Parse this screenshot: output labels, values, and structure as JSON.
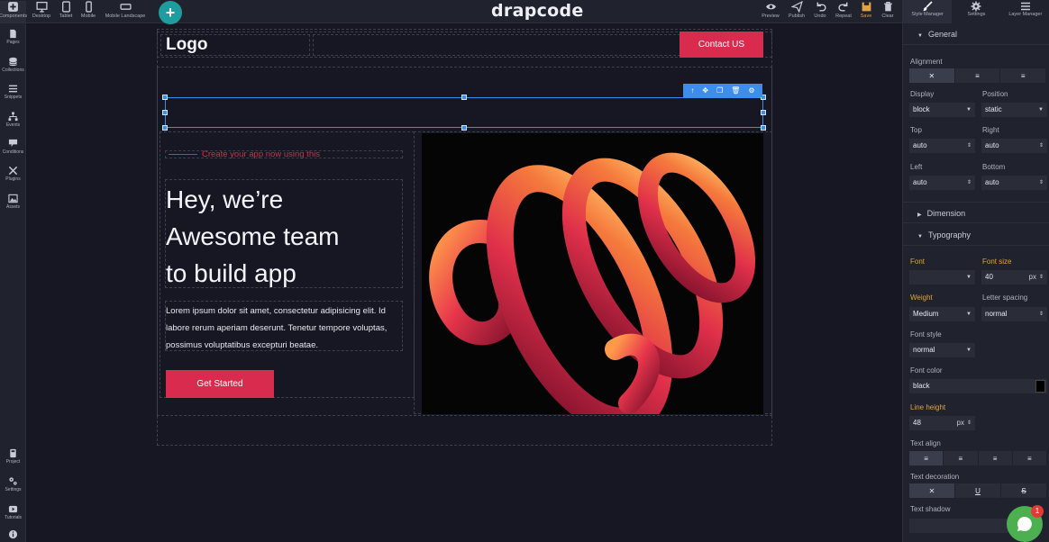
{
  "topbar": {
    "devices": [
      {
        "label": "Desktop",
        "icon": "desktop-icon"
      },
      {
        "label": "Tablet",
        "icon": "tablet-icon"
      },
      {
        "label": "Mobile",
        "icon": "mobile-icon"
      },
      {
        "label": "Mobile Landscape",
        "icon": "mobile-landscape-icon"
      }
    ],
    "brand": "drapcode",
    "actions": [
      {
        "label": "Preview",
        "icon": "eye-icon"
      },
      {
        "label": "Publish",
        "icon": "send-icon"
      },
      {
        "label": "Undo",
        "icon": "undo-icon"
      },
      {
        "label": "Repeat",
        "icon": "redo-icon"
      },
      {
        "label": "Save",
        "icon": "save-icon"
      },
      {
        "label": "Clear",
        "icon": "trash-icon"
      }
    ],
    "add_button": "+"
  },
  "leftbar": {
    "items": [
      {
        "label": "Components",
        "icon": "components-icon"
      },
      {
        "label": "Pages",
        "icon": "pages-icon"
      },
      {
        "label": "Collections",
        "icon": "collections-icon"
      },
      {
        "label": "Snippets",
        "icon": "snippets-icon"
      },
      {
        "label": "Events",
        "icon": "events-icon"
      },
      {
        "label": "Conditions",
        "icon": "conditions-icon"
      },
      {
        "label": "Plugins",
        "icon": "plugins-icon"
      },
      {
        "label": "Assets",
        "icon": "assets-icon"
      }
    ],
    "bottom_items": [
      {
        "label": "Project",
        "icon": "project-icon"
      },
      {
        "label": "Settings",
        "icon": "settings-icon"
      },
      {
        "label": "Tutorials",
        "icon": "tutorials-icon"
      },
      {
        "label": "",
        "icon": "info-icon"
      }
    ]
  },
  "canvas": {
    "nav_logo": "Logo",
    "contact_button": "Contact US",
    "tagline": "Create your app now using this",
    "hero_title": [
      "Hey, we’re",
      "Awesome team",
      "to build app"
    ],
    "hero_text": "Lorem ipsum dolor sit amet, consectetur adipisicing elit. Id labore rerum aperiam deserunt. Tenetur tempore voluptas, possimus voluptatibus excepturi beatae.",
    "get_started_button": "Get Started",
    "toolbar_icons": [
      "arrow-up-icon",
      "move-icon",
      "copy-icon",
      "delete-icon",
      "gear-icon"
    ],
    "toolbar_glyphs": [
      "↑",
      "✥",
      "❐",
      "🗑",
      "⚙"
    ]
  },
  "rightpanel": {
    "tabs": [
      {
        "label": "Style Manager",
        "icon": "brush-icon"
      },
      {
        "label": "Settings",
        "icon": "gear-icon"
      },
      {
        "label": "Layer Manager",
        "icon": "layers-icon"
      }
    ],
    "general": {
      "header": "General",
      "alignment_label": "Alignment",
      "alignment_options": [
        "✕",
        "≡",
        "≡"
      ],
      "display_label": "Display",
      "display_value": "block",
      "position_label": "Position",
      "position_value": "static",
      "top_label": "Top",
      "top_value": "auto",
      "right_label": "Right",
      "right_value": "auto",
      "left_label": "Left",
      "left_value": "auto",
      "bottom_label": "Bottom",
      "bottom_value": "auto"
    },
    "dimension": {
      "header": "Dimension"
    },
    "typography": {
      "header": "Typography",
      "font_label": "Font",
      "font_value": "",
      "font_size_label": "Font size",
      "font_size_value": "40",
      "font_size_unit": "px",
      "weight_label": "Weight",
      "weight_value": "Medium",
      "letter_spacing_label": "Letter spacing",
      "letter_spacing_value": "normal",
      "font_style_label": "Font style",
      "font_style_value": "normal",
      "font_color_label": "Font color",
      "font_color_value": "black",
      "line_height_label": "Line height",
      "line_height_value": "48",
      "line_height_unit": "px",
      "text_align_label": "Text align",
      "text_align_options": [
        "≡",
        "≡",
        "≡",
        "≡"
      ],
      "text_decoration_label": "Text decoration",
      "text_decoration_options": [
        "✕",
        "U",
        "S"
      ],
      "text_shadow_label": "Text shadow"
    },
    "chat_badge": "1"
  },
  "colors": {
    "accent": "#d92b4e",
    "selection": "#3d8eea",
    "add_button": "#1f9c9f",
    "label_highlight": "#e3a343"
  }
}
